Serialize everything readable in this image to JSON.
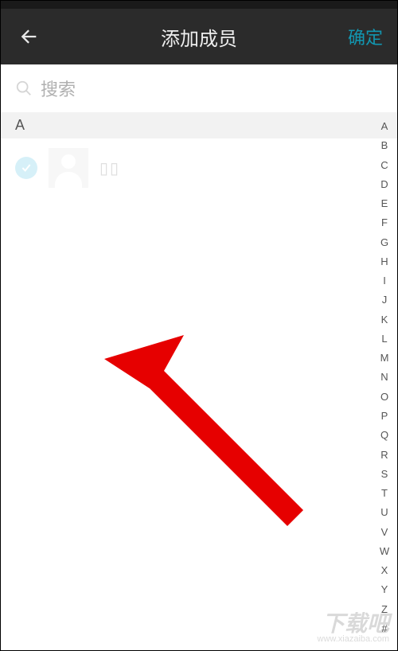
{
  "header": {
    "title": "添加成员",
    "confirm": "确定"
  },
  "search": {
    "placeholder": "搜索"
  },
  "sections": [
    {
      "letter": "A"
    }
  ],
  "contacts": [
    {
      "name": "▯▯",
      "checked": true
    }
  ],
  "index_letters": [
    "A",
    "B",
    "C",
    "D",
    "E",
    "F",
    "G",
    "H",
    "I",
    "J",
    "K",
    "L",
    "M",
    "N",
    "O",
    "P",
    "Q",
    "R",
    "S",
    "T",
    "U",
    "V",
    "W",
    "X",
    "Y",
    "Z",
    "#"
  ],
  "watermark": {
    "brand": "下载吧",
    "url": "www.xiazaiba.com"
  }
}
